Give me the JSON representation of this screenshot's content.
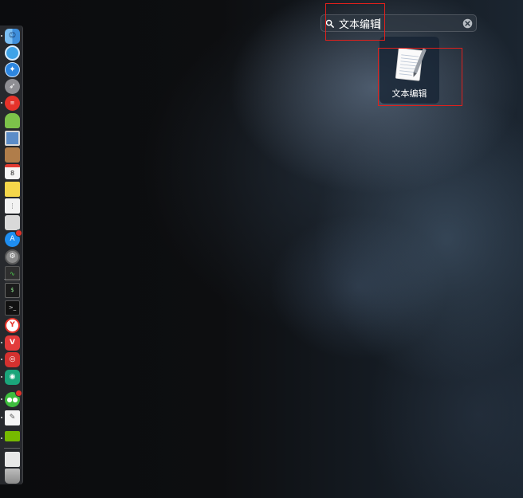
{
  "search": {
    "value": "文本编辑",
    "placeholder": "",
    "icon": "search-icon",
    "clear_icon": "clear-icon"
  },
  "results": [
    {
      "label": "文本编辑",
      "icon": "textedit-icon"
    }
  ],
  "annotation_color": "#e0201c",
  "dock": {
    "items": [
      {
        "name": "finder-icon",
        "color": "#4f9be6",
        "running": true
      },
      {
        "name": "network-icon",
        "color": "#3fa3e8",
        "running": false
      },
      {
        "name": "safari-icon",
        "color": "#2d86e0",
        "running": false
      },
      {
        "name": "rocket-icon",
        "color": "#8e8e93",
        "running": false
      },
      {
        "name": "todo-app-icon",
        "color": "#e6332a",
        "running": true
      },
      {
        "name": "android-icon",
        "color": "#7cc24a",
        "running": false
      },
      {
        "name": "preview-icon",
        "color": "#5b8cc8",
        "running": false
      },
      {
        "name": "contacts-icon",
        "color": "#b07d4a",
        "running": false
      },
      {
        "name": "calendar-icon",
        "color": "#f5f5f5",
        "running": false
      },
      {
        "name": "notes-icon",
        "color": "#f5d64a",
        "running": false
      },
      {
        "name": "reminders-icon",
        "color": "#f2f2f2",
        "running": false
      },
      {
        "name": "photos-tool-icon",
        "color": "#d9d9d9",
        "running": false
      },
      {
        "name": "app-store-icon",
        "color": "#1f8ef1",
        "running": false,
        "badge": true
      },
      {
        "name": "system-preferences-icon",
        "color": "#8a8a8a",
        "running": false
      },
      {
        "name": "activity-monitor-icon",
        "color": "#2f2f2f",
        "running": false
      },
      {
        "name": "console-icon",
        "color": "#1c1c1c",
        "running": false
      },
      {
        "name": "terminal-icon",
        "color": "#111111",
        "running": false
      },
      {
        "name": "yandex-icon",
        "color": "#e6332a",
        "running": false
      },
      {
        "name": "vivaldi-icon",
        "color": "#e33b3b",
        "running": true
      },
      {
        "name": "netease-music-icon",
        "color": "#d4312f",
        "running": true
      },
      {
        "name": "green-circle-app-icon",
        "color": "#1ba57a",
        "running": true
      },
      {
        "name": "wechat-icon",
        "color": "#3ebd3e",
        "running": true,
        "badge": true
      },
      {
        "name": "textedit-icon",
        "color": "#f5f5f5",
        "running": true
      },
      {
        "name": "nvidia-icon",
        "color": "#76b900",
        "running": true
      },
      {
        "name": "document-icon",
        "color": "#e8e8e8",
        "running": false
      },
      {
        "name": "trash-icon",
        "color": "#9a9a9a",
        "running": false
      }
    ]
  }
}
